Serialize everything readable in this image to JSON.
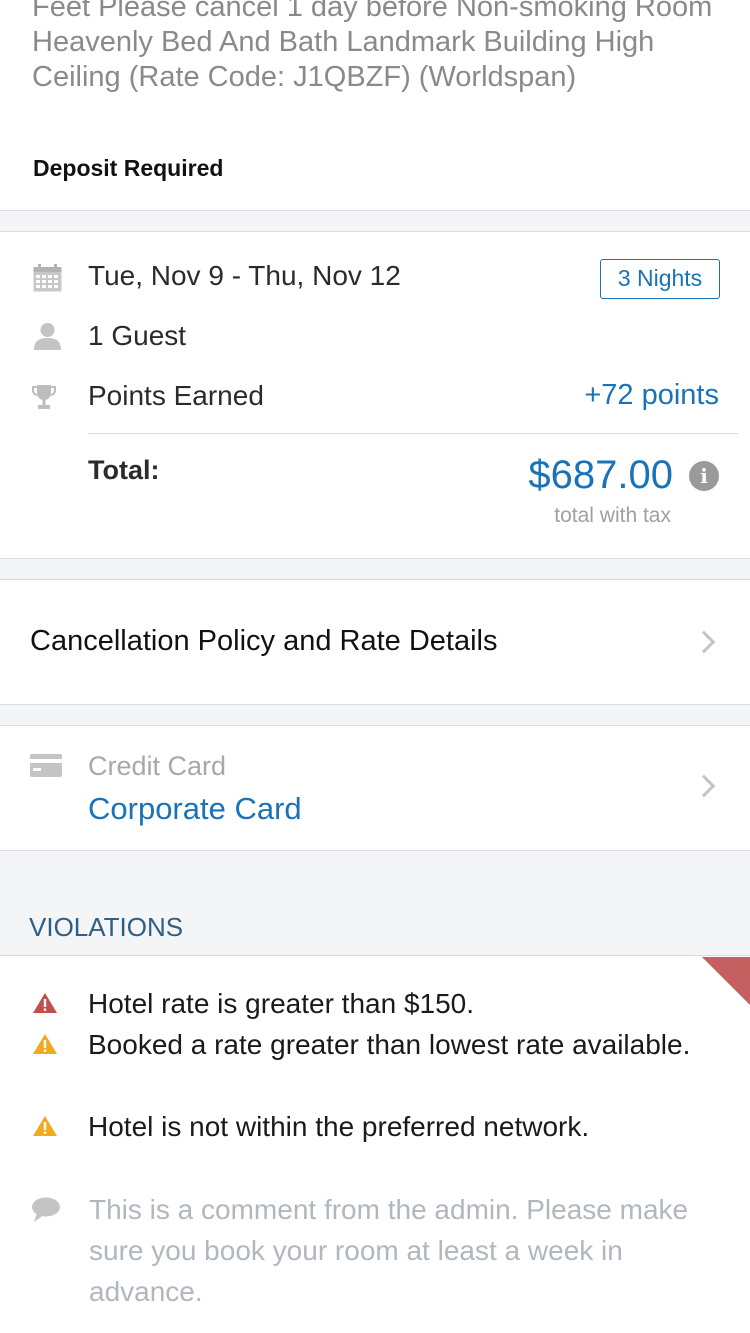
{
  "hotel_description": "Feet Please cancel 1 day before Non-smoking Room Heavenly Bed And Bath Landmark Building High Ceiling (Rate Code: J1QBZF)  (Worldspan)",
  "deposit_label": "Deposit Required",
  "stay": {
    "dates": "Tue, Nov 9 - Thu, Nov 12",
    "nights_badge": "3 Nights",
    "guests": "1 Guest",
    "points_label": "Points Earned",
    "points_value": "+72 points",
    "total_label": "Total:",
    "total_value": "$687.00",
    "total_subtext": "total with tax"
  },
  "cancellation": {
    "label": "Cancellation Policy and Rate Details"
  },
  "payment": {
    "label": "Credit Card",
    "value": "Corporate Card"
  },
  "violations": {
    "title": "VIOLATIONS",
    "items": [
      {
        "text": "Hotel rate is greater than $150.",
        "severity": "red",
        "color": "#c0504d"
      },
      {
        "text": "Booked a rate greater than lowest rate available.",
        "severity": "yellow",
        "color": "#f2a91d"
      },
      {
        "text": "Hotel is not within the preferred network.",
        "severity": "yellow",
        "color": "#f2a91d"
      }
    ],
    "comment": "This is a comment from the admin. Please make sure you book your room at least a week in advance."
  },
  "colors": {
    "accent": "#1a73b8",
    "violations_header": "#2f5f86",
    "corner_flag": "#c46060"
  },
  "icons": {
    "calendar": "calendar-icon",
    "guest": "person-icon",
    "points": "trophy-icon",
    "info": "info-icon",
    "card": "credit-card-icon",
    "comment": "speech-bubble-icon",
    "warning": "warning-triangle-icon"
  }
}
